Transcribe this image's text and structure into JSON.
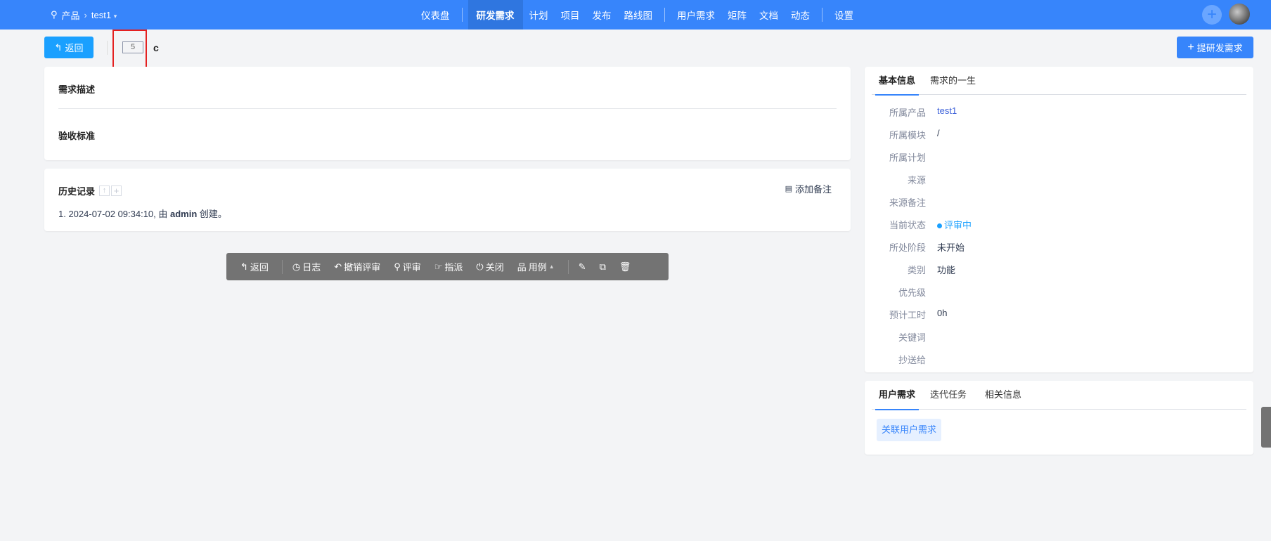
{
  "header": {
    "breadcrumb": {
      "root": "产品",
      "product": "test1"
    },
    "nav": [
      "仪表盘",
      "研发需求",
      "计划",
      "项目",
      "发布",
      "路线图",
      "用户需求",
      "矩阵",
      "文档",
      "动态",
      "设置"
    ],
    "active_nav": "研发需求"
  },
  "titlebar": {
    "back_label": "返回",
    "story_id": "5",
    "story_title": "c",
    "create_label": "提研发需求"
  },
  "main": {
    "description_label": "需求描述",
    "acceptance_label": "验收标准"
  },
  "history": {
    "title": "历史记录",
    "add_note": "添加备注",
    "entries": [
      {
        "prefix": "1. 2024-07-02 09:34:10, 由 ",
        "user": "admin",
        "suffix": " 创建。"
      }
    ]
  },
  "toolbar": {
    "back": "返回",
    "log": "日志",
    "revoke": "撤销评审",
    "review": "评审",
    "assign": "指派",
    "close": "关闭",
    "cases": "用例"
  },
  "basic": {
    "tabs": [
      "基本信息",
      "需求的一生"
    ],
    "fields": [
      {
        "label": "所属产品",
        "value": "test1"
      },
      {
        "label": "所属模块",
        "value": "/"
      },
      {
        "label": "所属计划",
        "value": ""
      },
      {
        "label": "来源",
        "value": ""
      },
      {
        "label": "来源备注",
        "value": ""
      },
      {
        "label": "当前状态",
        "value": "评审中"
      },
      {
        "label": "所处阶段",
        "value": "未开始"
      },
      {
        "label": "类别",
        "value": "功能"
      },
      {
        "label": "优先级",
        "value": ""
      },
      {
        "label": "预计工时",
        "value": "0h"
      },
      {
        "label": "关键词",
        "value": ""
      },
      {
        "label": "抄送给",
        "value": ""
      }
    ]
  },
  "related": {
    "tabs": [
      "用户需求",
      "迭代任务",
      "相关信息"
    ],
    "link_label": "关联用户需求"
  },
  "colors": {
    "primary": "#3785fb",
    "status": "#1aa0ff"
  }
}
